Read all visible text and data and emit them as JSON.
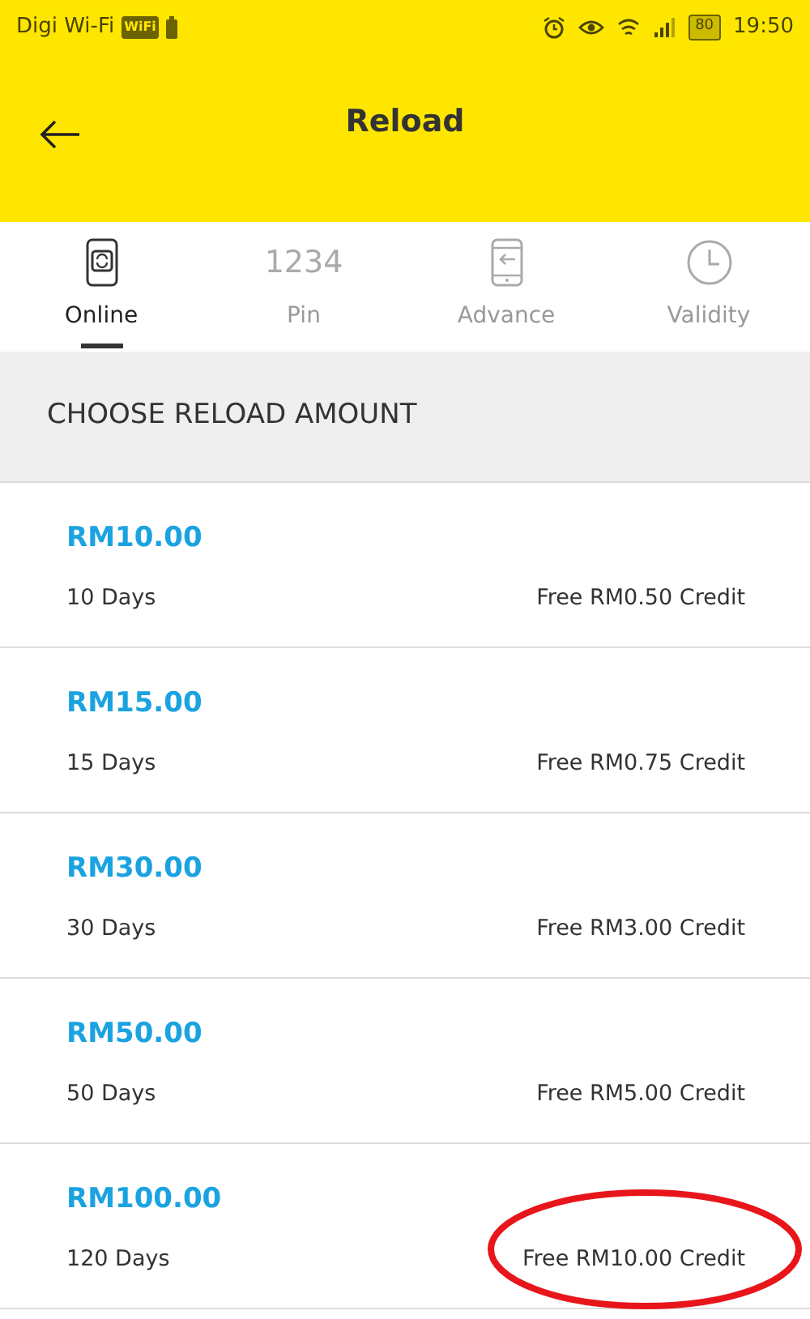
{
  "status_bar": {
    "carrier": "Digi Wi-Fi",
    "wifi_badge": "WiFi",
    "battery": "80",
    "time": "19:50"
  },
  "header": {
    "title": "Reload"
  },
  "tabs": [
    {
      "label": "Online",
      "kind": "phone-sync",
      "selected": true
    },
    {
      "label": "Pin",
      "kind": "digits",
      "digits": "1234",
      "selected": false
    },
    {
      "label": "Advance",
      "kind": "phone-arrow",
      "selected": false
    },
    {
      "label": "Validity",
      "kind": "clock",
      "selected": false
    }
  ],
  "section": {
    "title": "CHOOSE RELOAD AMOUNT"
  },
  "plans": [
    {
      "amount": "RM10.00",
      "validity": "10 Days",
      "bonus": "Free RM0.50 Credit",
      "highlighted": false
    },
    {
      "amount": "RM15.00",
      "validity": "15 Days",
      "bonus": "Free RM0.75 Credit",
      "highlighted": false
    },
    {
      "amount": "RM30.00",
      "validity": "30 Days",
      "bonus": "Free RM3.00 Credit",
      "highlighted": false
    },
    {
      "amount": "RM50.00",
      "validity": "50 Days",
      "bonus": "Free RM5.00 Credit",
      "highlighted": false
    },
    {
      "amount": "RM100.00",
      "validity": "120 Days",
      "bonus": "Free RM10.00 Credit",
      "highlighted": true
    }
  ]
}
